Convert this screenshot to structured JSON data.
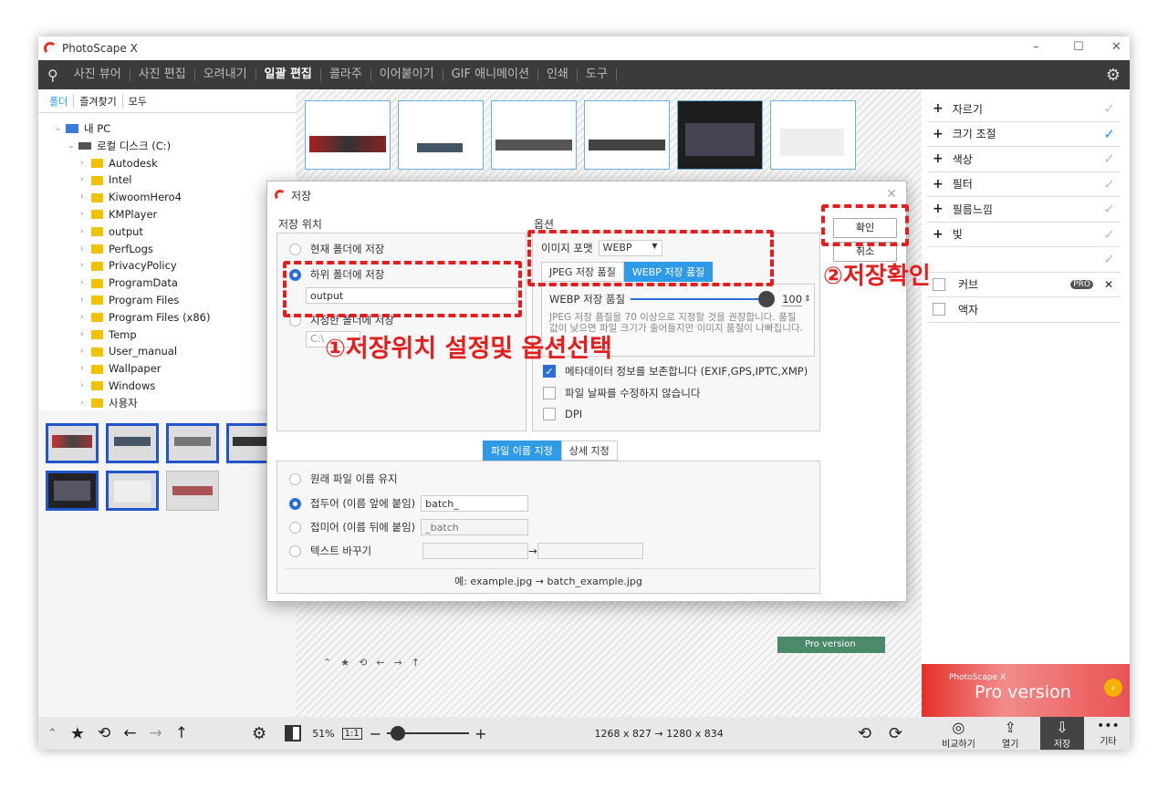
{
  "app": {
    "title": "PhotoScape X",
    "min": "–",
    "max": "☐",
    "close": "✕"
  },
  "menu": [
    "사진 뷰어",
    "사진 편집",
    "오려내기",
    "일괄 편집",
    "콜라주",
    "이어붙이기",
    "GIF 애니메이션",
    "인쇄",
    "도구"
  ],
  "menu_active": "일괄 편집",
  "left_tabs": [
    "폴더",
    "즐겨찾기",
    "모두"
  ],
  "tree": {
    "pc": "내 PC",
    "disk": "로컬 디스크 (C:)",
    "folders": [
      "Autodesk",
      "Intel",
      "KiwoomHero4",
      "KMPlayer",
      "output",
      "PerfLogs",
      "PrivacyPolicy",
      "ProgramData",
      "Program Files",
      "Program Files (x86)",
      "Temp",
      "User_manual",
      "Wallpaper",
      "Windows",
      "사용자"
    ]
  },
  "right_panel": {
    "items": [
      {
        "label": "자르기",
        "checked": false
      },
      {
        "label": "크기 조절",
        "checked": true
      },
      {
        "label": "색상",
        "checked": false
      },
      {
        "label": "필터",
        "checked": false
      },
      {
        "label": "필름느낌",
        "checked": false
      },
      {
        "label": "빛",
        "checked": false
      }
    ],
    "curve_label": "커브",
    "pro_badge": "PRO",
    "frame_label": "액자",
    "banner_small": "PhotoScape X",
    "banner_big": "Pro version"
  },
  "dialog": {
    "title": "저장",
    "save_location_title": "저장 위치",
    "options_title": "옵션",
    "radio_current": "현재 폴더에 저장",
    "radio_sub": "하위 폴더에 저장",
    "sub_folder_value": "output",
    "radio_specified": "지정한 폴더에 저장",
    "specified_path": "C:\\",
    "format_label": "이미지 포맷",
    "format_value": "WEBP",
    "tab_jpeg": "JPEG 저장 품질",
    "tab_webp": "WEBP 저장 품질",
    "webp_quality_label": "WEBP 저장 품질",
    "webp_quality_value": "100",
    "webp_desc": "JPEG 저장 품질을 70 이상으로 지정할 것을 권장합니다. 품질 값이 낮으면 파일 크기가 줄어들지만 이미지 품질이 나빠집니다.",
    "meta_label": "메타데이터 정보를 보존합니다 (EXIF,GPS,IPTC,XMP)",
    "date_label": "파일 날짜를 수정하지 않습니다",
    "dpi_label": "DPI",
    "ok": "확인",
    "cancel": "취소",
    "name_tab1": "파일 이름 지정",
    "name_tab2": "상세 지정",
    "keep_name": "원래 파일 이름 유지",
    "prefix_label": "접두어 (이름 앞에 붙임)",
    "prefix_value": "batch_",
    "suffix_label": "접미어 (이름 뒤에 붙임)",
    "suffix_placeholder": "_batch",
    "replace_label": "텍스트 바꾸기",
    "arrow": "→",
    "example": "예: example.jpg → batch_example.jpg"
  },
  "annotations": {
    "a1": "①저장위치 설정및 옵션선택",
    "a2": "②저장확인"
  },
  "bottombar": {
    "zoom": "51%",
    "one_to_one": "1:1",
    "dimensions": "1268 x 827 → 1280 x 834",
    "compare": "비교하기",
    "open": "열기",
    "save": "저장",
    "other": "기타"
  },
  "inner_strip": {
    "pro": "Pro version"
  },
  "colors": {
    "accent": "#2f9be6",
    "annotation": "#e41d1d",
    "menubar": "#3b3b3b"
  }
}
